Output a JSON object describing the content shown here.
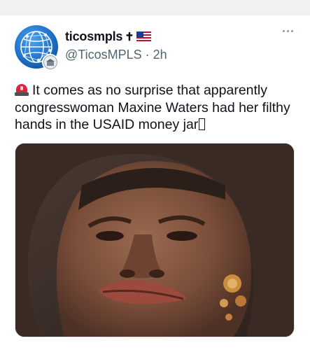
{
  "post": {
    "author": {
      "display_name": "ticosmpls",
      "name_badges": [
        "cross-symbol",
        "us-flag-icon"
      ],
      "cross_glyph": "✝",
      "handle": "@TicosMPLS",
      "separator": " · ",
      "time_ago": "2h",
      "avatar_icon": "globe-network-icon"
    },
    "more_icon": "more-options-icon",
    "text": {
      "leading_emoji": "siren-icon",
      "line": "It comes as no surprise that apparently congresswoman Maxine Waters had her filthy hands in the USAID money jar",
      "trailing_glyph": "missing-glyph"
    },
    "media": {
      "type": "photo",
      "alt_icon": "portrait-photo"
    }
  },
  "colors": {
    "text_primary": "#0f1419",
    "text_secondary": "#536471",
    "top_strip": "#f2f2f2"
  }
}
